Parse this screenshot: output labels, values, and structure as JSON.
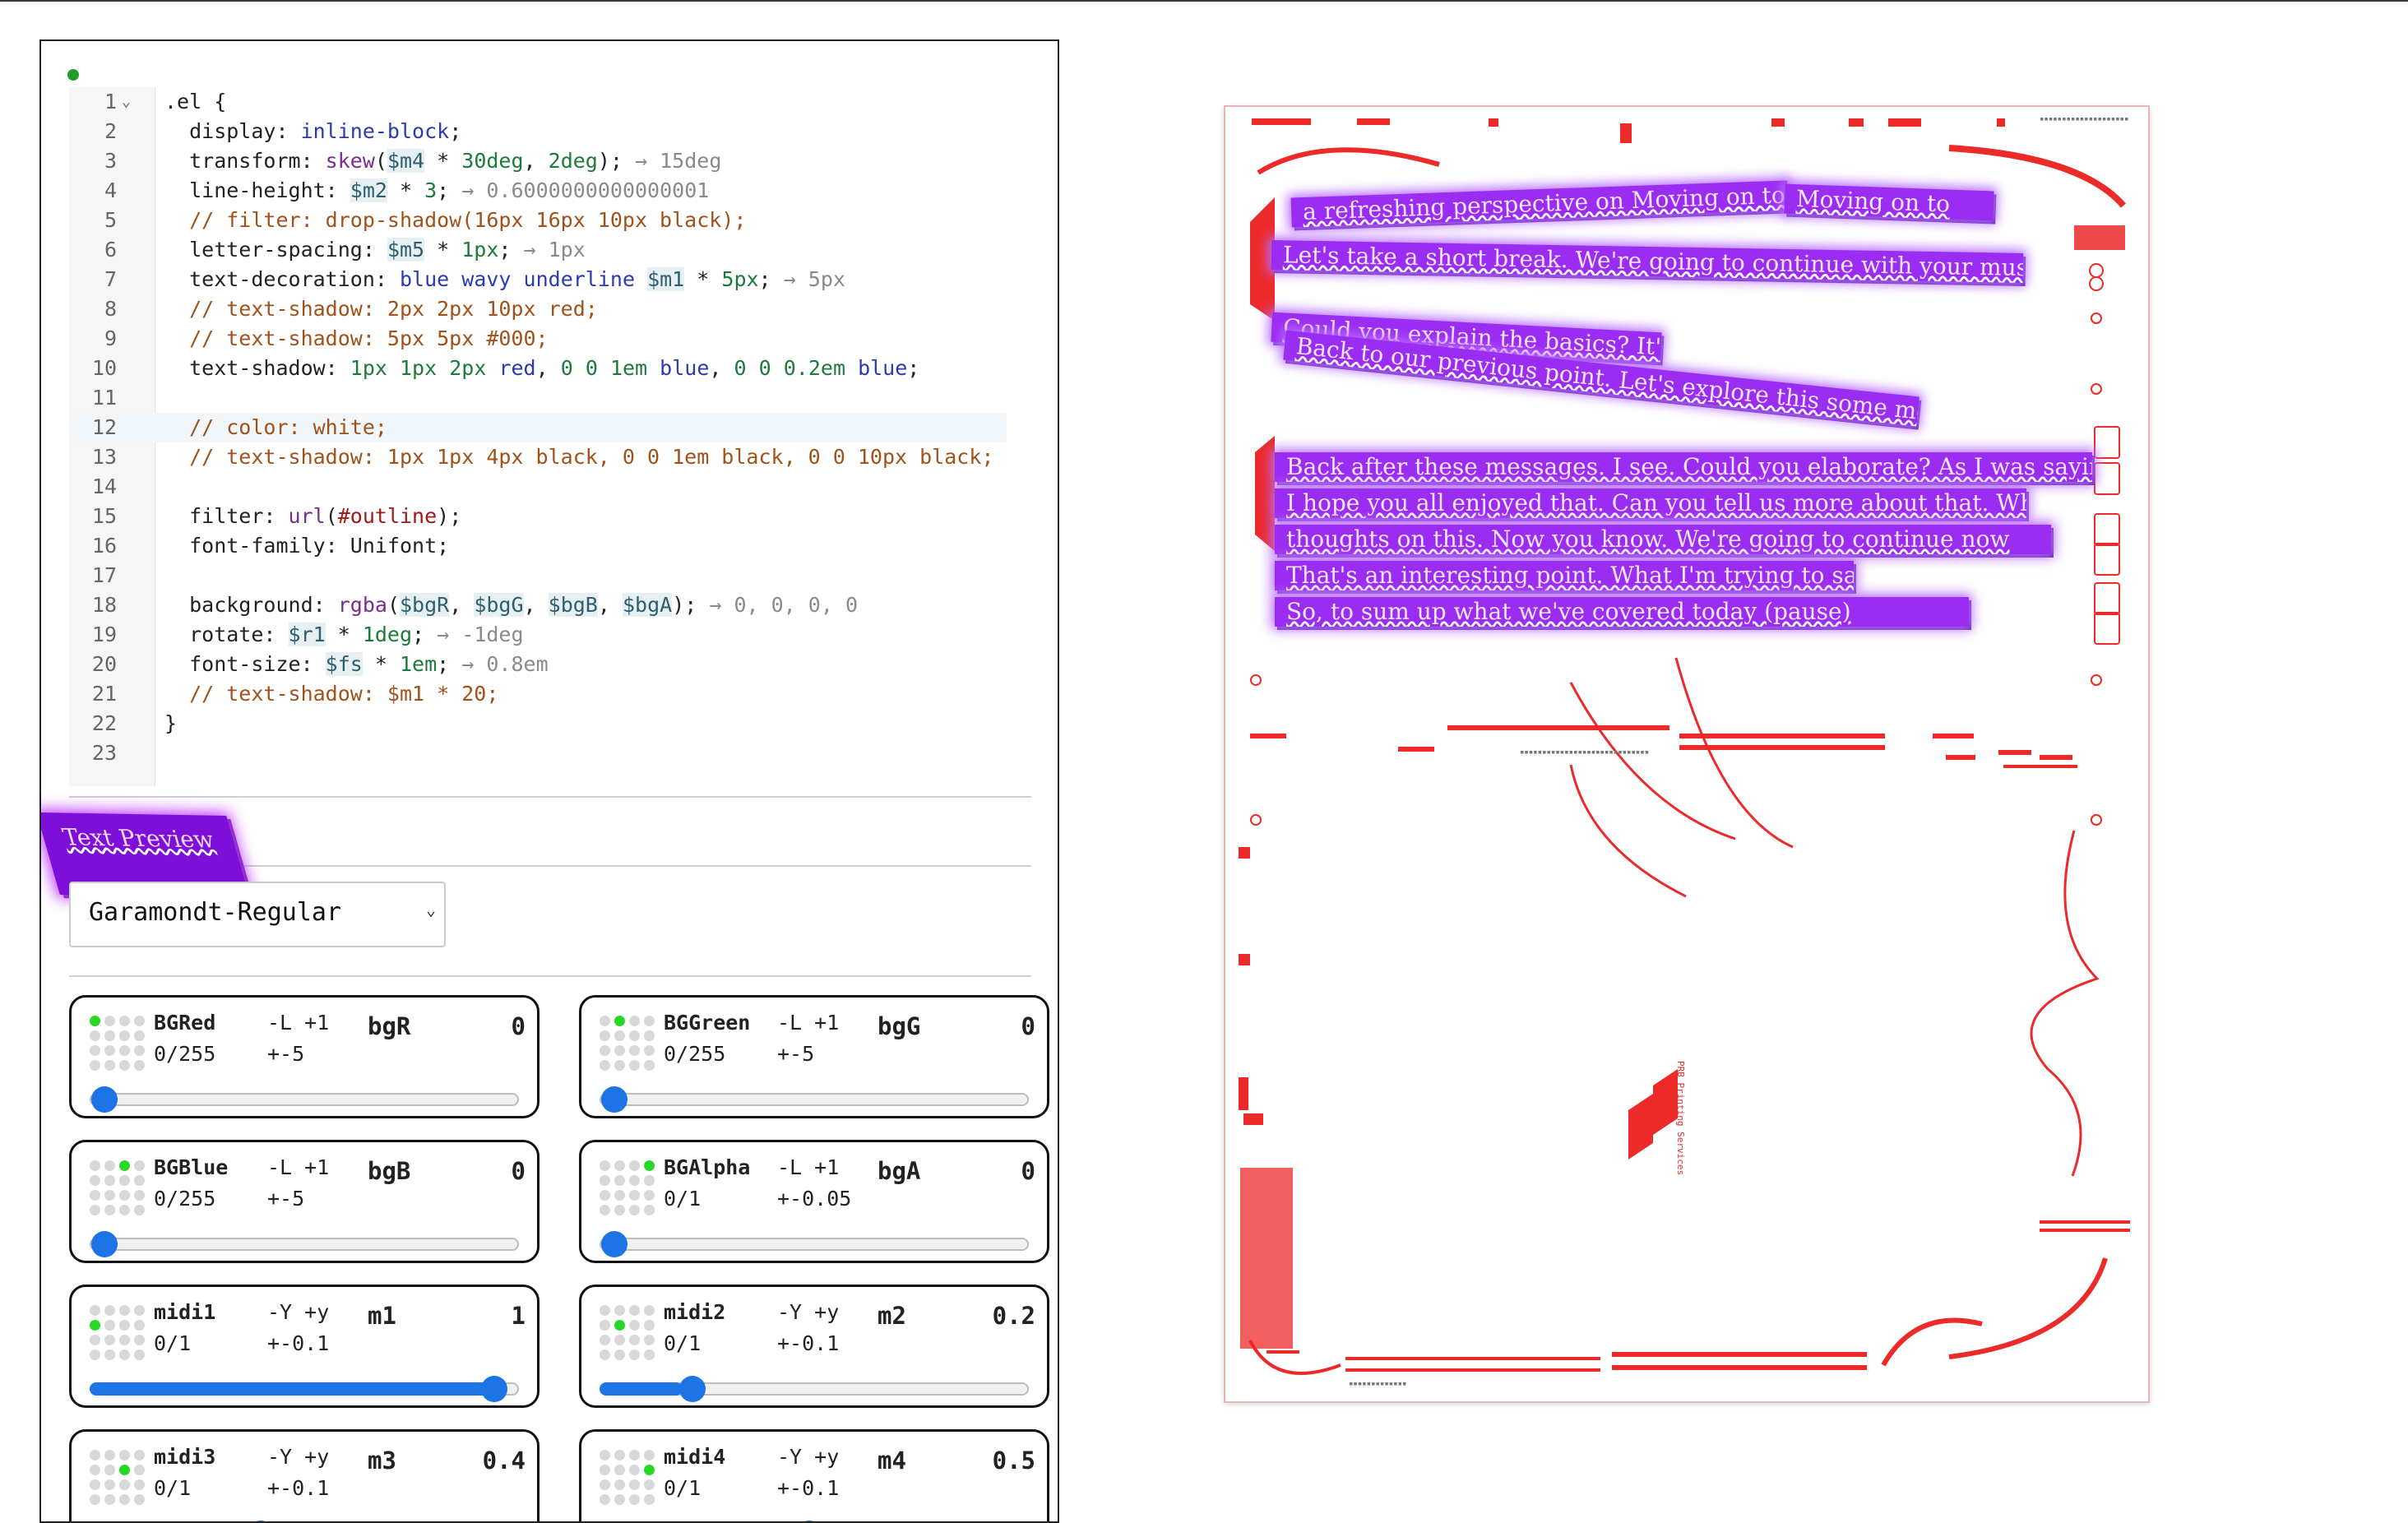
{
  "editor": {
    "lines": [
      {
        "n": "1",
        "text": ".el {"
      },
      {
        "n": "2",
        "text": "  display: inline-block;"
      },
      {
        "n": "3",
        "text": "  transform: skew($m4 * 30deg, 2deg);",
        "result": "→ 15deg"
      },
      {
        "n": "4",
        "text": "  line-height: $m2 * 3;",
        "result": "→ 0.6000000000000001"
      },
      {
        "n": "5",
        "text": "  // filter: drop-shadow(16px 16px 10px black);"
      },
      {
        "n": "6",
        "text": "  letter-spacing: $m5 * 1px;",
        "result": "→ 1px"
      },
      {
        "n": "7",
        "text": "  text-decoration: blue wavy underline $m1 * 5px;",
        "result": "→ 5px"
      },
      {
        "n": "8",
        "text": "  // text-shadow: 2px 2px 10px red;"
      },
      {
        "n": "9",
        "text": "  // text-shadow: 5px 5px #000;"
      },
      {
        "n": "10",
        "text": "  text-shadow: 1px 1px 2px red, 0 0 1em blue, 0 0 0.2em blue;"
      },
      {
        "n": "11",
        "text": ""
      },
      {
        "n": "12",
        "text": "  // color: white;"
      },
      {
        "n": "13",
        "text": "  // text-shadow: 1px 1px 4px black, 0 0 1em black, 0 0 10px black;"
      },
      {
        "n": "14",
        "text": ""
      },
      {
        "n": "15",
        "text": "  filter: url(#outline);"
      },
      {
        "n": "16",
        "text": "  font-family: Unifont;"
      },
      {
        "n": "17",
        "text": ""
      },
      {
        "n": "18",
        "text": "  background: rgba($bgR, $bgG, $bgB, $bgA);",
        "result": "→ 0, 0, 0, 0"
      },
      {
        "n": "19",
        "text": "  rotate: $r1 * 1deg;",
        "result": "→ -1deg"
      },
      {
        "n": "20",
        "text": "  font-size: $fs * 1em;",
        "result": "→ 0.8em"
      },
      {
        "n": "21",
        "text": "  // text-shadow: $m1 * 20;"
      },
      {
        "n": "22",
        "text": "}"
      },
      {
        "n": "23",
        "text": ""
      }
    ]
  },
  "preview": {
    "label": "Text Preview"
  },
  "font_select": {
    "value": "Garamondt-Regular"
  },
  "controls": [
    {
      "name": "BGRed",
      "range": "0/255",
      "keys": "-L +1",
      "step": "+-5",
      "var": "bgR",
      "value": "0",
      "fraction": 0.0,
      "dot_on": [
        0
      ]
    },
    {
      "name": "BGGreen",
      "range": "0/255",
      "keys": "-L +1",
      "step": "+-5",
      "var": "bgG",
      "value": "0",
      "fraction": 0.0,
      "dot_on": [
        1
      ]
    },
    {
      "name": "BGBlue",
      "range": "0/255",
      "keys": "-L +1",
      "step": "+-5",
      "var": "bgB",
      "value": "0",
      "fraction": 0.0,
      "dot_on": [
        2
      ]
    },
    {
      "name": "BGAlpha",
      "range": "0/1",
      "keys": "-L +1",
      "step": "+-0.05",
      "var": "bgA",
      "value": "0",
      "fraction": 0.0,
      "dot_on": [
        3
      ]
    },
    {
      "name": "midi1",
      "range": "0/1",
      "keys": "-Y +y",
      "step": "+-0.1",
      "var": "m1",
      "value": "1",
      "fraction": 1.0,
      "dot_on": [
        4
      ]
    },
    {
      "name": "midi2",
      "range": "0/1",
      "keys": "-Y +y",
      "step": "+-0.1",
      "var": "m2",
      "value": "0.2",
      "fraction": 0.2,
      "dot_on": [
        5
      ]
    },
    {
      "name": "midi3",
      "range": "0/1",
      "keys": "-Y +y",
      "step": "+-0.1",
      "var": "m3",
      "value": "0.4",
      "fraction": 0.4,
      "dot_on": [
        6
      ]
    },
    {
      "name": "midi4",
      "range": "0/1",
      "keys": "-Y +y",
      "step": "+-0.1",
      "var": "m4",
      "value": "0.5",
      "fraction": 0.5,
      "dot_on": [
        7
      ]
    }
  ],
  "poster": {
    "text_lines": [
      "a refreshing perspective on Moving on to",
      "Let's take a short break. We're going to continue with your music now",
      "Could you explain the basics? It's not quite that",
      "Back to our previous point. Let's explore this some more further",
      "Back after these messages. I see. Could you elaborate? As I was saying before",
      "I hope you all enjoyed that. Can you tell us more about that. What are your",
      "thoughts on this. Now you know. We're going to continue now",
      "That's an interesting point. What I'm trying to say is",
      "So, to sum up what we've covered today (pause)"
    ],
    "brand_text": "PRB Printing Services"
  },
  "colors": {
    "accent_blue": "#1c74e6",
    "dot_active": "#27d827",
    "poster_red": "#ec2a2a",
    "text_glow": "#9b2cf2"
  }
}
